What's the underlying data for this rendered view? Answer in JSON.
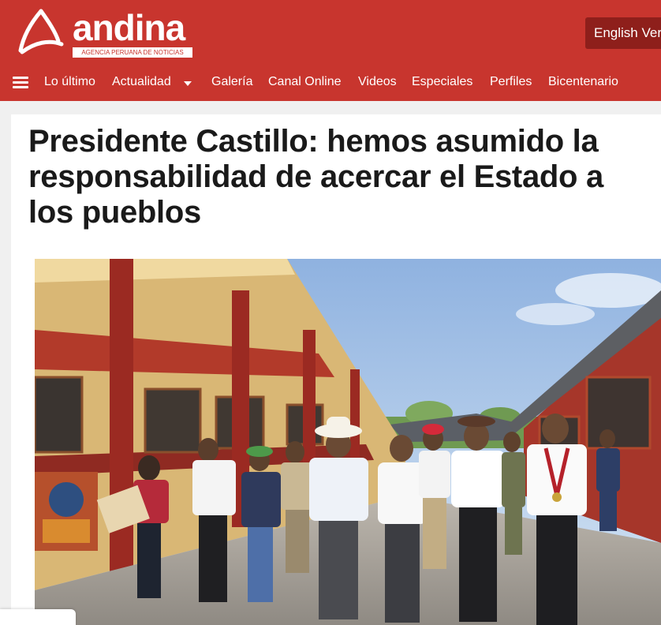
{
  "brand": {
    "name": "andina",
    "tagline": "AGENCIA PERUANA DE NOTICIAS",
    "primary_color": "#c8352e"
  },
  "header": {
    "english_button": "English Ver"
  },
  "nav": {
    "menu_icon": "hamburger-menu-icon",
    "items": [
      "Lo último",
      "Actualidad",
      "Galería",
      "Canal Online",
      "Videos",
      "Especiales",
      "Perfiles",
      "Bicentenario"
    ]
  },
  "article": {
    "title": "Presidente Castillo: hemos asumido la responsabilidad de acercar el Estado a los pueblos"
  }
}
